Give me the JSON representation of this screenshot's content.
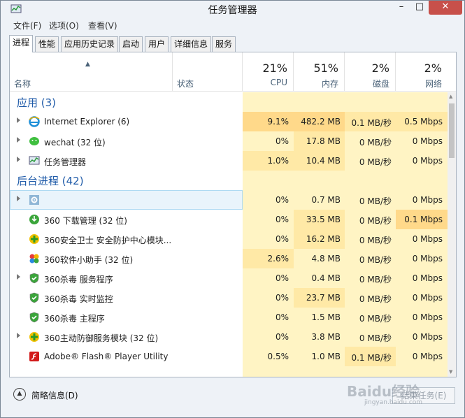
{
  "window": {
    "title": "任务管理器",
    "controls": {
      "minimize": "–",
      "maximize": "□",
      "close": "✕"
    }
  },
  "menu": [
    {
      "label": "文件(F)"
    },
    {
      "label": "选项(O)"
    },
    {
      "label": "查看(V)"
    }
  ],
  "tabs": [
    {
      "label": "进程",
      "active": true
    },
    {
      "label": "性能"
    },
    {
      "label": "应用历史记录"
    },
    {
      "label": "启动"
    },
    {
      "label": "用户"
    },
    {
      "label": "详细信息"
    },
    {
      "label": "服务"
    }
  ],
  "columns": {
    "sort_arrow": "▲",
    "name": "名称",
    "status": "状态",
    "cpu": {
      "pct": "21%",
      "label": "CPU"
    },
    "memory": {
      "pct": "51%",
      "label": "内存"
    },
    "disk": {
      "pct": "2%",
      "label": "磁盘"
    },
    "network": {
      "pct": "2%",
      "label": "网络"
    }
  },
  "groups": {
    "apps": "应用 (3)",
    "background": "后台进程 (42)"
  },
  "colors": {
    "heat_light": "#fff4c4",
    "heat_medium": "#ffe9a6",
    "heat_strong": "#ffd98a",
    "selected_bg": "#e9f4fb",
    "group_title": "#1e5aa8"
  },
  "rows": [
    {
      "kind": "group",
      "label": "应用 (3)"
    },
    {
      "kind": "proc",
      "icon": "ie-icon",
      "name": "Internet Explorer (6)",
      "expandable": true,
      "cpu": "9.1%",
      "mem": "482.2 MB",
      "disk": "0.1 MB/秒",
      "net": "0.5 Mbps",
      "heat": [
        "strong",
        "strong",
        "medium",
        "medium"
      ]
    },
    {
      "kind": "proc",
      "icon": "wechat-icon",
      "name": "wechat (32 位)",
      "expandable": true,
      "cpu": "0%",
      "mem": "17.8 MB",
      "disk": "0 MB/秒",
      "net": "0 Mbps",
      "heat": [
        "light",
        "medium",
        "light",
        "light"
      ]
    },
    {
      "kind": "proc",
      "icon": "task-manager-icon",
      "name": "任务管理器",
      "expandable": true,
      "cpu": "1.0%",
      "mem": "10.4 MB",
      "disk": "0 MB/秒",
      "net": "0 Mbps",
      "heat": [
        "medium",
        "medium",
        "light",
        "light"
      ]
    },
    {
      "kind": "group",
      "label": "后台进程 (42)"
    },
    {
      "kind": "proc",
      "icon": "gear-icon",
      "name": "",
      "expandable": true,
      "selected": true,
      "cpu": "0%",
      "mem": "0.7 MB",
      "disk": "0 MB/秒",
      "net": "0 Mbps",
      "heat": [
        "light",
        "light",
        "light",
        "light"
      ]
    },
    {
      "kind": "proc",
      "icon": "download-icon",
      "name": "360 下载管理 (32 位)",
      "expandable": false,
      "cpu": "0%",
      "mem": "33.5 MB",
      "disk": "0 MB/秒",
      "net": "0.1 Mbps",
      "heat": [
        "light",
        "medium",
        "light",
        "strong"
      ]
    },
    {
      "kind": "proc",
      "icon": "360-guard-icon",
      "name": "360安全卫士 安全防护中心模块...",
      "expandable": false,
      "cpu": "0%",
      "mem": "16.2 MB",
      "disk": "0 MB/秒",
      "net": "0 Mbps",
      "heat": [
        "light",
        "medium",
        "light",
        "light"
      ]
    },
    {
      "kind": "proc",
      "icon": "360-helper-icon",
      "name": "360软件小助手 (32 位)",
      "expandable": false,
      "cpu": "2.6%",
      "mem": "4.8 MB",
      "disk": "0 MB/秒",
      "net": "0 Mbps",
      "heat": [
        "medium",
        "light",
        "light",
        "light"
      ]
    },
    {
      "kind": "proc",
      "icon": "shield-icon",
      "name": "360杀毒 服务程序",
      "expandable": true,
      "cpu": "0%",
      "mem": "0.4 MB",
      "disk": "0 MB/秒",
      "net": "0 Mbps",
      "heat": [
        "light",
        "light",
        "light",
        "light"
      ]
    },
    {
      "kind": "proc",
      "icon": "shield-icon",
      "name": "360杀毒 实时监控",
      "expandable": false,
      "cpu": "0%",
      "mem": "23.7 MB",
      "disk": "0 MB/秒",
      "net": "0 Mbps",
      "heat": [
        "light",
        "medium",
        "light",
        "light"
      ]
    },
    {
      "kind": "proc",
      "icon": "shield-icon",
      "name": "360杀毒 主程序",
      "expandable": false,
      "cpu": "0%",
      "mem": "1.5 MB",
      "disk": "0 MB/秒",
      "net": "0 Mbps",
      "heat": [
        "light",
        "light",
        "light",
        "light"
      ]
    },
    {
      "kind": "proc",
      "icon": "360-guard-icon",
      "name": "360主动防御服务模块 (32 位)",
      "expandable": true,
      "cpu": "0%",
      "mem": "3.8 MB",
      "disk": "0 MB/秒",
      "net": "0 Mbps",
      "heat": [
        "light",
        "light",
        "light",
        "light"
      ]
    },
    {
      "kind": "proc",
      "icon": "flash-icon",
      "name": "Adobe® Flash® Player Utility",
      "expandable": false,
      "cpu": "0.5%",
      "mem": "1.0 MB",
      "disk": "0.1 MB/秒",
      "net": "0 Mbps",
      "heat": [
        "light",
        "light",
        "medium",
        "light"
      ]
    }
  ],
  "footer": {
    "fewer_details": "简略信息(D)",
    "end_task": "结束任务(E)",
    "watermark": "Baidu经验",
    "watermark_sub": "jingyan.baidu.com"
  }
}
